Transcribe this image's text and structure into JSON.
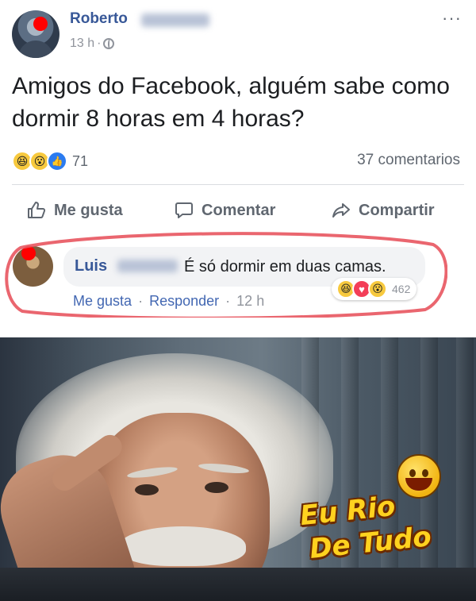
{
  "post": {
    "author": "Roberto",
    "time": "13 h",
    "meta_separator": "·",
    "more": "···",
    "text": "Amigos do Facebook, alguém sabe como dormir 8 horas em 4 horas?",
    "reaction_icons": [
      "haha",
      "wow",
      "like"
    ],
    "reaction_count": "71",
    "comments_count": "37 comentarios"
  },
  "actions": {
    "like": "Me gusta",
    "comment": "Comentar",
    "share": "Compartir"
  },
  "comment": {
    "author": "Luis",
    "text": "É só dormir em duas camas.",
    "reaction_icons": [
      "haha",
      "love",
      "wow"
    ],
    "reaction_count": "462",
    "like": "Me gusta",
    "reply": "Responder",
    "time": "12 h",
    "separator": "·"
  },
  "watermark": {
    "line1": "Eu Rio",
    "line2": "De Tudo"
  },
  "colors": {
    "link": "#385898",
    "secondary_text": "#606770",
    "highlight_circle": "#e8555f",
    "privacy_dot": "#ff0000"
  }
}
